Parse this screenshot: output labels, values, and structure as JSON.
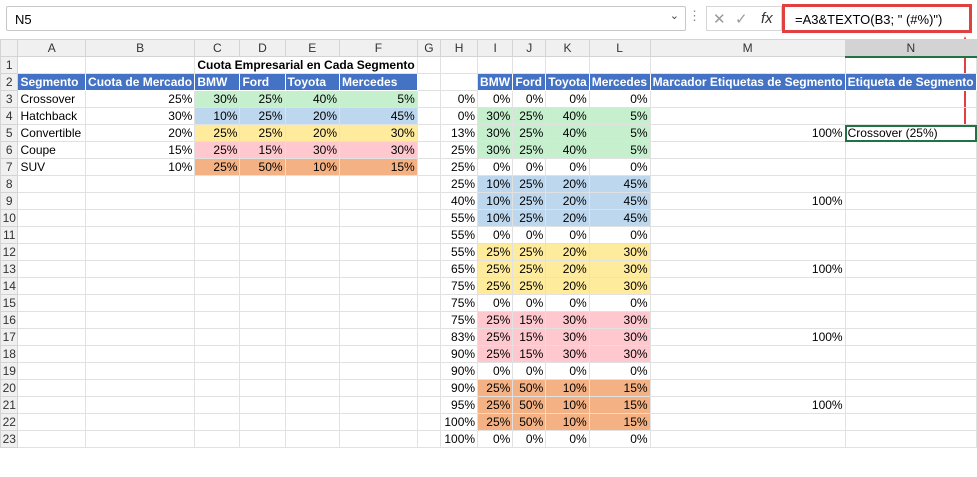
{
  "namebox": {
    "value": "N5"
  },
  "formula": {
    "value": "=A3&TEXTO(B3; \" (#%)\")"
  },
  "columns": [
    "A",
    "B",
    "C",
    "D",
    "E",
    "F",
    "G",
    "H",
    "I",
    "J",
    "K",
    "L",
    "M",
    "N"
  ],
  "rows": [
    {
      "n": "1",
      "A": "",
      "B": "",
      "C": "Cuota Empresarial en Cada Segmento",
      "H": "",
      "I": "",
      "J": "",
      "K": "",
      "L": "",
      "M": "",
      "N": ""
    },
    {
      "n": "2",
      "A": "Segmento",
      "B": "Cuota de Mercado",
      "C": "BMW",
      "D": "Ford",
      "E": "Toyota",
      "F": "Mercedes",
      "H": "",
      "I": "BMW",
      "J": "Ford",
      "K": "Toyota",
      "L": "Mercedes",
      "M": "Marcador Etiquetas de Segmento",
      "N": "Etiqueta de Segmento"
    },
    {
      "n": "3",
      "A": "Crossover",
      "B": "25%",
      "C": "30%",
      "D": "25%",
      "E": "40%",
      "F": "5%",
      "H": "0%",
      "I": "0%",
      "J": "0%",
      "K": "0%",
      "L": "0%",
      "M": "",
      "N": ""
    },
    {
      "n": "4",
      "A": "Hatchback",
      "B": "30%",
      "C": "10%",
      "D": "25%",
      "E": "20%",
      "F": "45%",
      "H": "0%",
      "I": "30%",
      "J": "25%",
      "K": "40%",
      "L": "5%",
      "M": "",
      "N": ""
    },
    {
      "n": "5",
      "A": "Convertible",
      "B": "20%",
      "C": "25%",
      "D": "25%",
      "E": "20%",
      "F": "30%",
      "H": "13%",
      "I": "30%",
      "J": "25%",
      "K": "40%",
      "L": "5%",
      "M": "100%",
      "N": "Crossover (25%)"
    },
    {
      "n": "6",
      "A": "Coupe",
      "B": "15%",
      "C": "25%",
      "D": "15%",
      "E": "30%",
      "F": "30%",
      "H": "25%",
      "I": "30%",
      "J": "25%",
      "K": "40%",
      "L": "5%",
      "M": "",
      "N": ""
    },
    {
      "n": "7",
      "A": "SUV",
      "B": "10%",
      "C": "25%",
      "D": "50%",
      "E": "10%",
      "F": "15%",
      "H": "25%",
      "I": "0%",
      "J": "0%",
      "K": "0%",
      "L": "0%",
      "M": "",
      "N": ""
    },
    {
      "n": "8",
      "H": "25%",
      "I": "10%",
      "J": "25%",
      "K": "20%",
      "L": "45%",
      "M": ""
    },
    {
      "n": "9",
      "H": "40%",
      "I": "10%",
      "J": "25%",
      "K": "20%",
      "L": "45%",
      "M": "100%"
    },
    {
      "n": "10",
      "H": "55%",
      "I": "10%",
      "J": "25%",
      "K": "20%",
      "L": "45%",
      "M": ""
    },
    {
      "n": "11",
      "H": "55%",
      "I": "0%",
      "J": "0%",
      "K": "0%",
      "L": "0%",
      "M": ""
    },
    {
      "n": "12",
      "H": "55%",
      "I": "25%",
      "J": "25%",
      "K": "20%",
      "L": "30%",
      "M": ""
    },
    {
      "n": "13",
      "H": "65%",
      "I": "25%",
      "J": "25%",
      "K": "20%",
      "L": "30%",
      "M": "100%"
    },
    {
      "n": "14",
      "H": "75%",
      "I": "25%",
      "J": "25%",
      "K": "20%",
      "L": "30%",
      "M": ""
    },
    {
      "n": "15",
      "H": "75%",
      "I": "0%",
      "J": "0%",
      "K": "0%",
      "L": "0%",
      "M": ""
    },
    {
      "n": "16",
      "H": "75%",
      "I": "25%",
      "J": "15%",
      "K": "30%",
      "L": "30%",
      "M": ""
    },
    {
      "n": "17",
      "H": "83%",
      "I": "25%",
      "J": "15%",
      "K": "30%",
      "L": "30%",
      "M": "100%"
    },
    {
      "n": "18",
      "H": "90%",
      "I": "25%",
      "J": "15%",
      "K": "30%",
      "L": "30%",
      "M": ""
    },
    {
      "n": "19",
      "H": "90%",
      "I": "0%",
      "J": "0%",
      "K": "0%",
      "L": "0%",
      "M": ""
    },
    {
      "n": "20",
      "H": "90%",
      "I": "25%",
      "J": "50%",
      "K": "10%",
      "L": "15%",
      "M": ""
    },
    {
      "n": "21",
      "H": "95%",
      "I": "25%",
      "J": "50%",
      "K": "10%",
      "L": "15%",
      "M": "100%"
    },
    {
      "n": "22",
      "H": "100%",
      "I": "25%",
      "J": "50%",
      "K": "10%",
      "L": "15%",
      "M": ""
    },
    {
      "n": "23",
      "H": "100%",
      "I": "0%",
      "J": "0%",
      "K": "0%",
      "L": "0%",
      "M": ""
    }
  ],
  "colors": {
    "header_blue": "#4472c4",
    "green": "#c6efce",
    "blue_light": "#bdd7ee",
    "yellow": "#ffeb9c",
    "pink": "#ffc7ce",
    "orange": "#f4b183",
    "highlight_red": "#e0403f"
  }
}
